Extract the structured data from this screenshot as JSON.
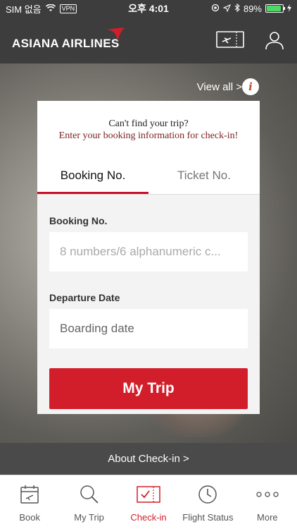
{
  "status_bar": {
    "carrier": "SIM 없음",
    "vpn": "VPN",
    "time": "오후 4:01",
    "battery": "89%",
    "battery_level": 0.89
  },
  "header": {
    "brand": "ASIANA AIRLINES",
    "icons": [
      "boarding-pass-icon",
      "user-icon"
    ]
  },
  "view_all": {
    "label": "View all >",
    "info": "i"
  },
  "card": {
    "message_line1": "Can't find your trip?",
    "message_line2": "Enter your booking information for check-in!",
    "tabs": [
      {
        "label": "Booking No.",
        "active": true
      },
      {
        "label": "Ticket No.",
        "active": false
      }
    ],
    "booking_label": "Booking No.",
    "booking_placeholder": "8 numbers/6 alphanumeric c...",
    "date_label": "Departure Date",
    "date_placeholder": "Boarding date",
    "submit": "My Trip"
  },
  "about_checkin": "About Check-in >",
  "tabbar": [
    {
      "label": "Book",
      "icon": "calendar-icon"
    },
    {
      "label": "My Trip",
      "icon": "magnifier-icon"
    },
    {
      "label": "Check-in",
      "icon": "ticket-check-icon",
      "active": true
    },
    {
      "label": "Flight Status",
      "icon": "clock-icon"
    },
    {
      "label": "More",
      "icon": "more-dots-icon"
    }
  ],
  "colors": {
    "accent": "#d21e2b",
    "header_bg": "#3d3d3d",
    "form_bg": "#f3f3f3"
  }
}
